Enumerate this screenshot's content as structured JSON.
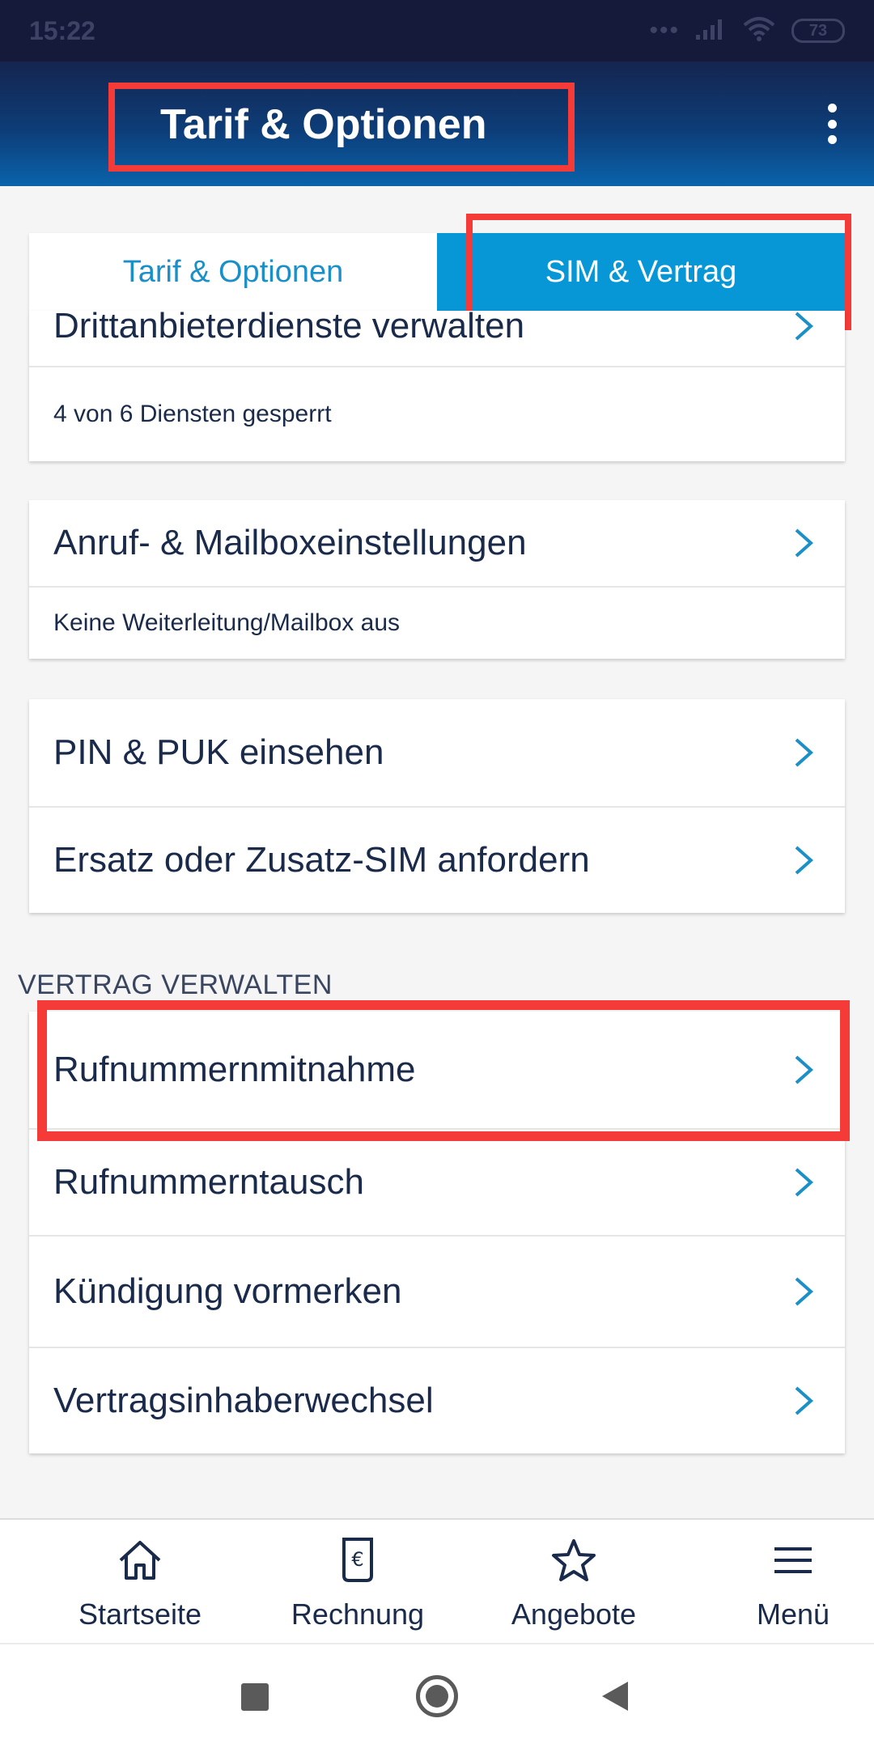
{
  "status_bar": {
    "time": "15:22",
    "signal_dots": "•••",
    "battery": "73"
  },
  "app_bar": {
    "title": "Tarif & Optionen"
  },
  "tabs": [
    {
      "label": "Tarif & Optionen",
      "active": false
    },
    {
      "label": "SIM & Vertrag",
      "active": true
    }
  ],
  "cards": {
    "third_party": {
      "title": "Drittanbieterdienste verwalten",
      "subtitle": "4 von 6 Diensten gesperrt"
    },
    "call_settings": {
      "title": "Anruf- & Mailboxeinstellungen",
      "subtitle": "Keine Weiterleitung/Mailbox aus"
    },
    "sim": {
      "items": [
        "PIN & PUK einsehen",
        "Ersatz oder Zusatz-SIM anfordern"
      ]
    }
  },
  "contract": {
    "section_label": "VERTRAG VERWALTEN",
    "items": [
      "Rufnummernmitnahme",
      "Rufnummerntausch",
      "Kündigung vormerken",
      "Vertragsinhaberwechsel"
    ]
  },
  "bottom_nav": [
    {
      "label": "Startseite",
      "icon": "home-icon"
    },
    {
      "label": "Rechnung",
      "icon": "invoice-icon"
    },
    {
      "label": "Angebote",
      "icon": "star-icon"
    },
    {
      "label": "Menü",
      "icon": "menu-icon"
    }
  ],
  "colors": {
    "accent": "#0897d6",
    "highlight": "#f53b37",
    "text": "#1a2a4a",
    "app_bar_top": "#15254f",
    "app_bar_bottom": "#0a63ab"
  }
}
